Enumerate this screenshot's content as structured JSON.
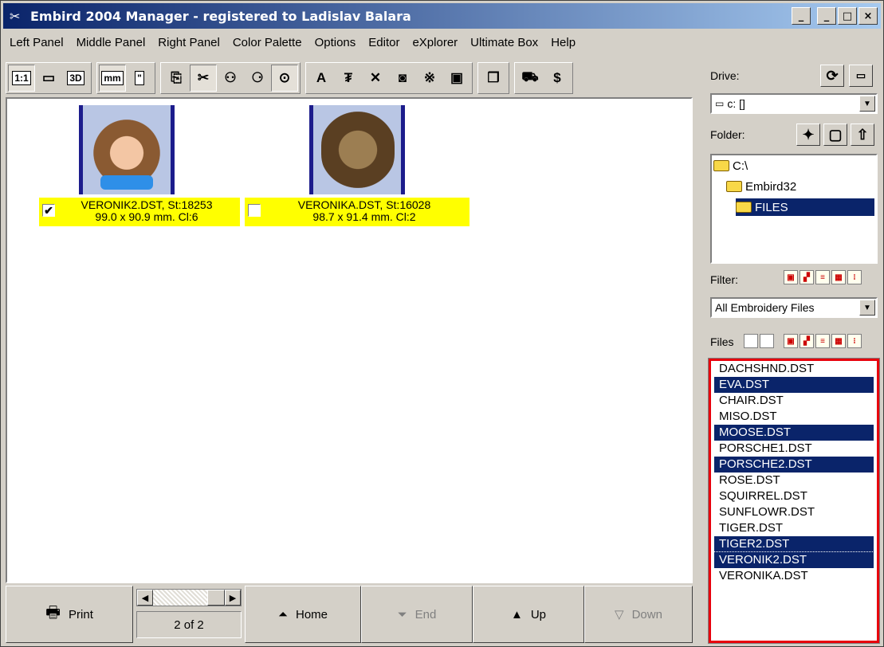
{
  "title": "Embird 2004 Manager - registered to Ladislav Balara",
  "window_buttons": [
    "_",
    "_",
    "□",
    "×"
  ],
  "menu": [
    "Left Panel",
    "Middle Panel",
    "Right Panel",
    "Color Palette",
    "Options",
    "Editor",
    "eXplorer",
    "Ultimate Box",
    "Help"
  ],
  "toolbar": {
    "scale_label": "1:1",
    "view3d_label": "3D",
    "mm_label": "mm",
    "inch_label": "\""
  },
  "designs": [
    {
      "name": "VERONIK2.DST, St:18253",
      "dims": "99.0 x 90.9 mm. Cl:6",
      "checked": true
    },
    {
      "name": "VERONIKA.DST, St:16028",
      "dims": "98.7 x 91.4 mm. Cl:2",
      "checked": false
    }
  ],
  "nav": {
    "print": "Print",
    "page": "2 of 2",
    "home": "Home",
    "end": "End",
    "up": "Up",
    "down": "Down"
  },
  "right_panel": {
    "drive_label": "Drive:",
    "drive_value": "c: []",
    "folder_label": "Folder:",
    "folders": [
      "C:\\",
      "Embird32",
      "FILES"
    ],
    "filter_label": "Filter:",
    "filter_value": "All Embroidery Files",
    "files_label": "Files"
  },
  "files": [
    {
      "name": "DACHSHND.DST",
      "selected": false
    },
    {
      "name": "EVA.DST",
      "selected": true
    },
    {
      "name": "CHAIR.DST",
      "selected": false
    },
    {
      "name": "MISO.DST",
      "selected": false
    },
    {
      "name": "MOOSE.DST",
      "selected": true
    },
    {
      "name": "PORSCHE1.DST",
      "selected": false
    },
    {
      "name": "PORSCHE2.DST",
      "selected": true
    },
    {
      "name": "ROSE.DST",
      "selected": false
    },
    {
      "name": "SQUIRREL.DST",
      "selected": false
    },
    {
      "name": "SUNFLOWR.DST",
      "selected": false
    },
    {
      "name": "TIGER.DST",
      "selected": false
    },
    {
      "name": "TIGER2.DST",
      "selected": true
    },
    {
      "name": "VERONIK2.DST",
      "selected": true
    },
    {
      "name": "VERONIKA.DST",
      "selected": false
    }
  ],
  "colors": {
    "title_start": "#0a246a",
    "title_end": "#a6caf0",
    "selection": "#0a246a",
    "label_bg": "#ffff00",
    "highlight_border": "#e8000c"
  }
}
